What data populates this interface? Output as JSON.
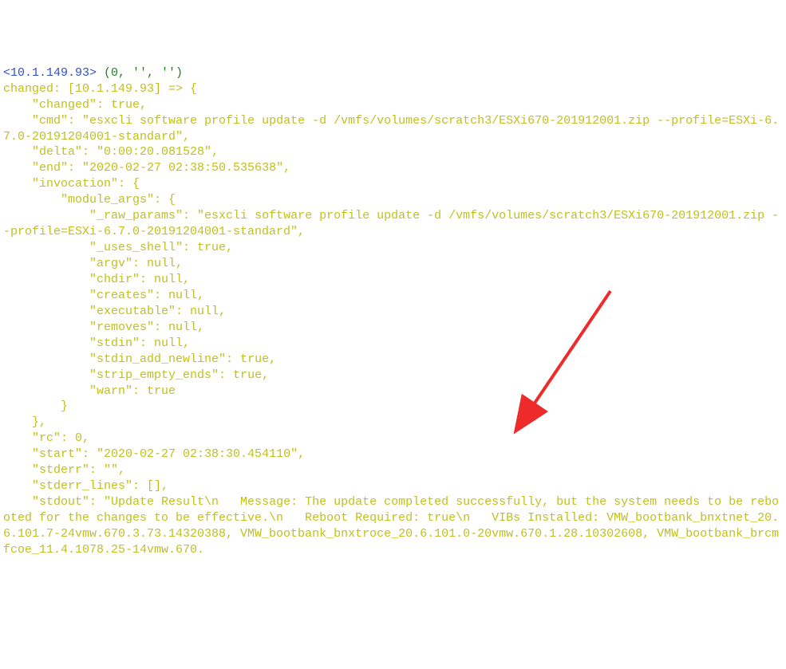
{
  "header": {
    "ip": "<10.1.149.93>",
    "tuple": " (0, '', '')"
  },
  "output": {
    "l1": "changed: [10.1.149.93] => {",
    "l2": "    \"changed\": true,",
    "l3": "    \"cmd\": \"esxcli software profile update -d /vmfs/volumes/scratch3/ESXi670-201912001.zip --profile=ESXi-6.7.0-20191204001-standard\",",
    "l4": "    \"delta\": \"0:00:20.081528\",",
    "l5": "    \"end\": \"2020-02-27 02:38:50.535638\",",
    "l6": "    \"invocation\": {",
    "l7": "        \"module_args\": {",
    "l8": "            \"_raw_params\": \"esxcli software profile update -d /vmfs/volumes/scratch3/ESXi670-201912001.zip --profile=ESXi-6.7.0-20191204001-standard\",",
    "l9": "            \"_uses_shell\": true,",
    "l10": "            \"argv\": null,",
    "l11": "            \"chdir\": null,",
    "l12": "            \"creates\": null,",
    "l13": "            \"executable\": null,",
    "l14": "            \"removes\": null,",
    "l15": "            \"stdin\": null,",
    "l16": "            \"stdin_add_newline\": true,",
    "l17": "            \"strip_empty_ends\": true,",
    "l18": "            \"warn\": true",
    "l19": "        }",
    "l20": "    },",
    "l21": "    \"rc\": 0,",
    "l22": "    \"start\": \"2020-02-27 02:38:30.454110\",",
    "l23": "    \"stderr\": \"\",",
    "l24": "    \"stderr_lines\": [],",
    "l25": "    \"stdout\": \"Update Result\\n   Message: The update completed successfully, but the system needs to be rebooted for the changes to be effective.\\n   Reboot Required: true\\n   VIBs Installed: VMW_bootbank_bnxtnet_20.6.101.7-24vmw.670.3.73.14320388, VMW_bootbank_bnxtroce_20.6.101.0-20vmw.670.1.28.10302608, VMW_bootbank_brcmfcoe_11.4.1078.25-14vmw.670."
  }
}
